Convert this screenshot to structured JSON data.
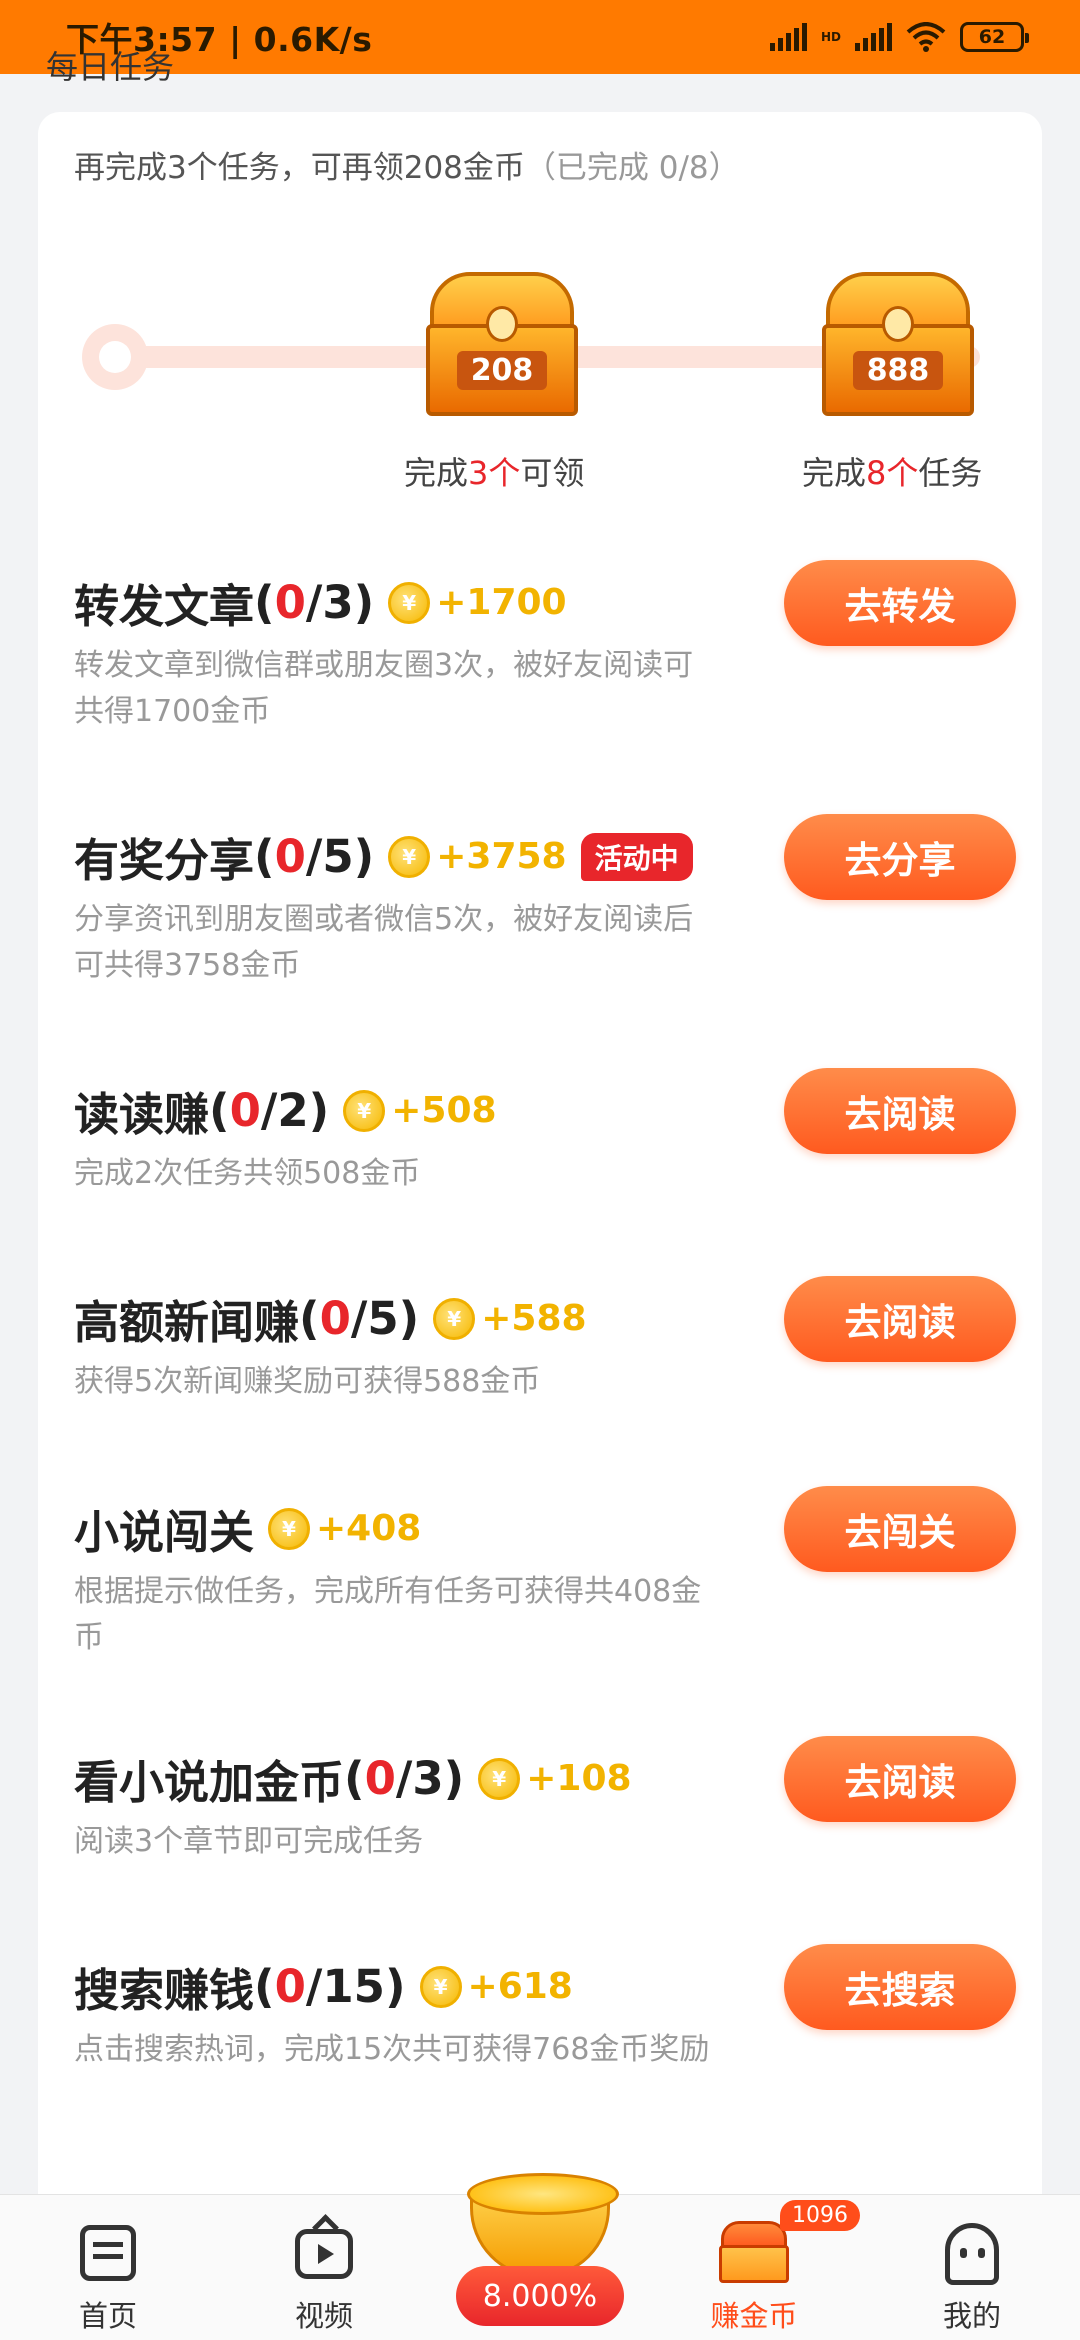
{
  "status_bar": {
    "time_speed": "下午3:57 | 0.6K/s",
    "hd_label": "HD",
    "battery": "62"
  },
  "section_title": "每日任务",
  "summary": {
    "text": "再完成3个任务，可再领208金币",
    "progress": "（已完成 0/8）",
    "completed": 0,
    "total": 8
  },
  "milestones": [
    {
      "amount": "208",
      "caption_pre": "完成",
      "caption_num": "3个",
      "caption_post": "可领"
    },
    {
      "amount": "888",
      "caption_pre": "完成",
      "caption_num": "8个",
      "caption_post": "任务"
    }
  ],
  "tasks": [
    {
      "title": "转发文章",
      "prog_open": "(",
      "done": "0",
      "total": "/3)",
      "reward": "+1700",
      "badge": "",
      "desc": "转发文章到微信群或朋友圈3次，被好友阅读可共得1700金币",
      "button": "去转发"
    },
    {
      "title": "有奖分享",
      "prog_open": "(",
      "done": "0",
      "total": "/5)",
      "reward": "+3758",
      "badge": "活动中",
      "desc": "分享资讯到朋友圈或者微信5次，被好友阅读后可共得3758金币",
      "button": "去分享"
    },
    {
      "title": "读读赚",
      "prog_open": "(",
      "done": "0",
      "total": "/2)",
      "reward": "+508",
      "badge": "",
      "desc": "完成2次任务共领508金币",
      "button": "去阅读"
    },
    {
      "title": "高额新闻赚",
      "prog_open": "(",
      "done": "0",
      "total": "/5)",
      "reward": "+588",
      "badge": "",
      "desc": "获得5次新闻赚奖励可获得588金币",
      "button": "去阅读"
    },
    {
      "title": "小说闯关",
      "prog_open": "",
      "done": "",
      "total": "",
      "reward": "+408",
      "badge": "",
      "desc": "根据提示做任务，完成所有任务可获得共408金币",
      "button": "去闯关"
    },
    {
      "title": "看小说加金币",
      "prog_open": "(",
      "done": "0",
      "total": "/3)",
      "reward": "+108",
      "badge": "",
      "desc": "阅读3个章节即可完成任务",
      "button": "去阅读"
    },
    {
      "title": "搜索赚钱",
      "prog_open": "(",
      "done": "0",
      "total": "/15)",
      "reward": "+618",
      "badge": "",
      "desc": "点击搜索热词，完成15次共可获得768金币奖励",
      "button": "去搜索"
    }
  ],
  "coin_symbol": "¥",
  "bottom_nav": {
    "home": "首页",
    "video": "视频",
    "center_rate": "8.000%",
    "earn": "赚金币",
    "earn_badge": "1096",
    "mine": "我的"
  },
  "colors": {
    "status_bar": "#ff7a00",
    "accent": "#ff5a1f",
    "progress_red": "#e8262b",
    "reward_gold": "#f2b300"
  }
}
